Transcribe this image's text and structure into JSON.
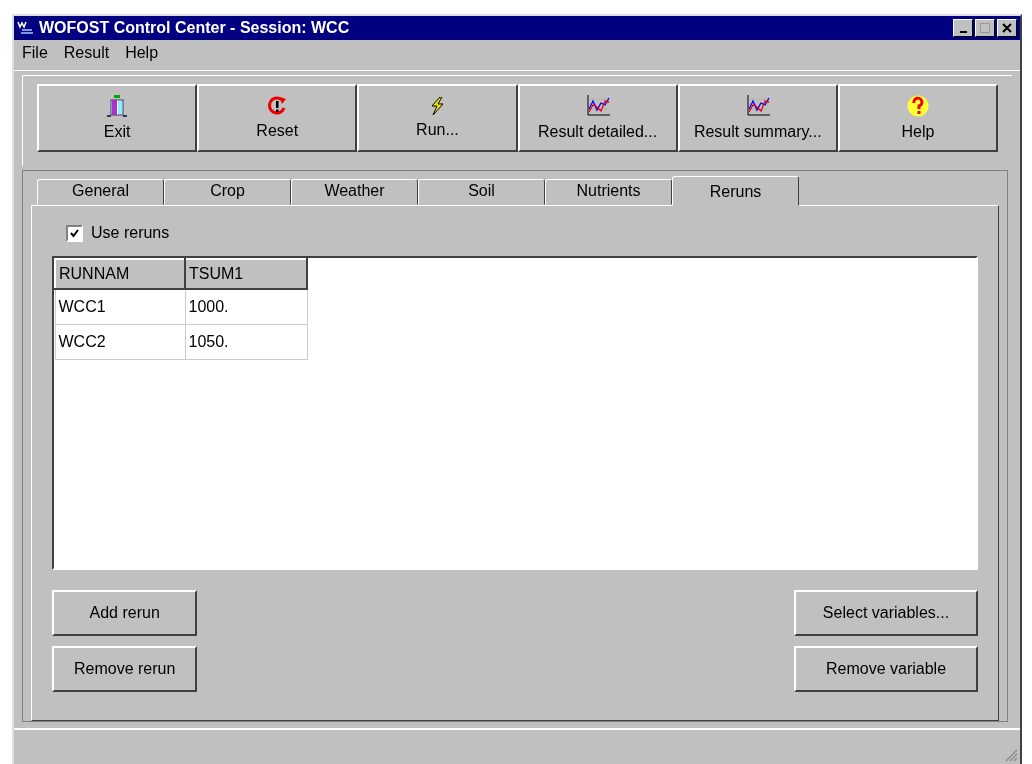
{
  "window": {
    "title": "WOFOST Control Center - Session: WCC"
  },
  "menu": [
    "File",
    "Result",
    "Help"
  ],
  "toolbar": [
    {
      "label": "Exit",
      "kind": "exit"
    },
    {
      "label": "Reset",
      "kind": "reset"
    },
    {
      "label": "Run...",
      "kind": "run"
    },
    {
      "label": "Result detailed...",
      "kind": "chart"
    },
    {
      "label": "Result summary...",
      "kind": "chart"
    },
    {
      "label": "Help",
      "kind": "help"
    }
  ],
  "tabs": [
    {
      "label": "General",
      "selected": false
    },
    {
      "label": "Crop",
      "selected": false
    },
    {
      "label": "Weather",
      "selected": false
    },
    {
      "label": "Soil",
      "selected": false
    },
    {
      "label": "Nutrients",
      "selected": false
    },
    {
      "label": "Reruns",
      "selected": true
    }
  ],
  "use_reruns": {
    "label": "Use reruns",
    "checked": true
  },
  "table": {
    "columns": [
      "RUNNAM",
      "TSUM1"
    ],
    "rows": [
      [
        "WCC1",
        "1000."
      ],
      [
        "WCC2",
        "1050."
      ]
    ]
  },
  "left_buttons": [
    "Add rerun",
    "Remove rerun"
  ],
  "right_buttons": [
    "Select variables...",
    "Remove variable"
  ]
}
